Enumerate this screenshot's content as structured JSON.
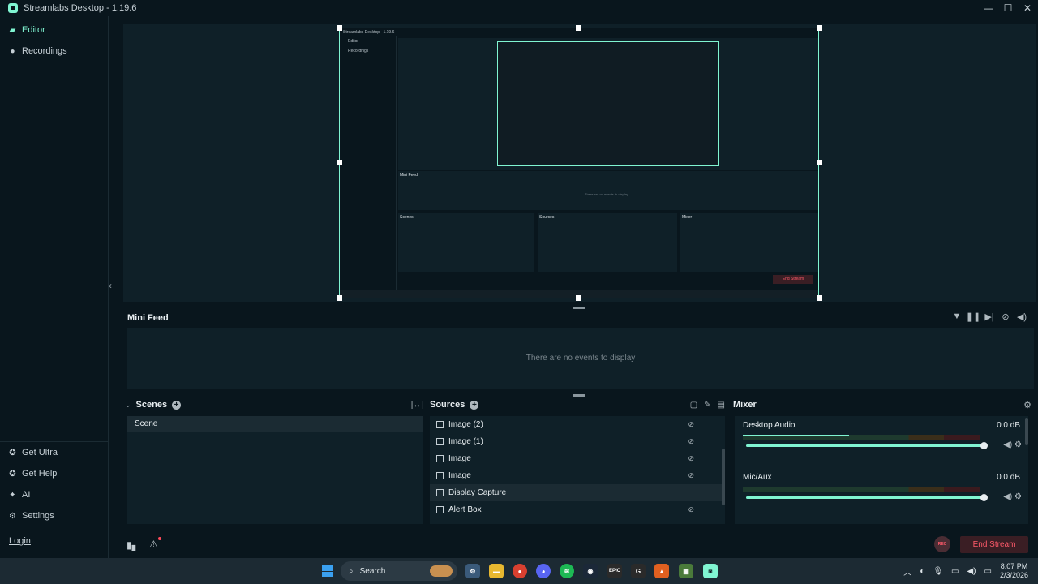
{
  "window": {
    "title": "Streamlabs Desktop - 1.19.6",
    "minimize": "—",
    "maximize": "☐",
    "close": "✕"
  },
  "sidebar": {
    "top_items": [
      {
        "label": "Editor",
        "icon": "editor-icon",
        "active": true
      },
      {
        "label": "Recordings",
        "icon": "play-circle-icon"
      }
    ],
    "bottom_items": [
      {
        "label": "Get Ultra",
        "icon": "ultra-icon"
      },
      {
        "label": "Get Help",
        "icon": "help-icon"
      },
      {
        "label": "AI",
        "icon": "sparkle-icon"
      },
      {
        "label": "Settings",
        "icon": "gear-icon"
      }
    ],
    "login": "Login",
    "collapse": "‹"
  },
  "nested_preview": {
    "title": "Streamlabs Desktop - 1.19.6",
    "editor": "Editor",
    "recordings": "Recordings",
    "mini_feed": "Mini Feed",
    "empty": "There are no events to display",
    "scenes": "Scenes",
    "sources": "Sources",
    "mixer": "Mixer",
    "end_stream": "End Stream"
  },
  "minifeed": {
    "title": "Mini Feed",
    "empty_text": "There are no events to display",
    "tools": [
      "filter-icon",
      "pause-icon",
      "skip-icon",
      "mute-alerts-icon",
      "volume-icon"
    ]
  },
  "scenes": {
    "title": "Scenes",
    "items": [
      "Scene"
    ]
  },
  "sources": {
    "title": "Sources",
    "items": [
      {
        "label": "Image (2)",
        "icon": "image-icon",
        "selected": false
      },
      {
        "label": "Image (1)",
        "icon": "image-icon",
        "selected": false
      },
      {
        "label": "Image",
        "icon": "image-icon",
        "selected": false
      },
      {
        "label": "Image",
        "icon": "image-icon",
        "selected": false
      },
      {
        "label": "Display Capture",
        "icon": "monitor-icon",
        "selected": true
      },
      {
        "label": "Alert Box",
        "icon": "image-icon",
        "selected": false
      }
    ]
  },
  "mixer": {
    "title": "Mixer",
    "channels": [
      {
        "name": "Desktop Audio",
        "db": "0.0 dB",
        "level": 0.45,
        "volume": 1.0
      },
      {
        "name": "Mic/Aux",
        "db": "0.0 dB",
        "level": 0.0,
        "volume": 1.0
      }
    ]
  },
  "bottombar": {
    "rec": "REC",
    "end_stream": "End Stream"
  },
  "taskbar": {
    "search_placeholder": "Search",
    "time": "8:07 PM",
    "date": "2/3/2026"
  },
  "colors": {
    "accent": "#80f5d2",
    "danger": "#ff5a6a",
    "bg": "#09161d",
    "panel": "#0f2028"
  }
}
